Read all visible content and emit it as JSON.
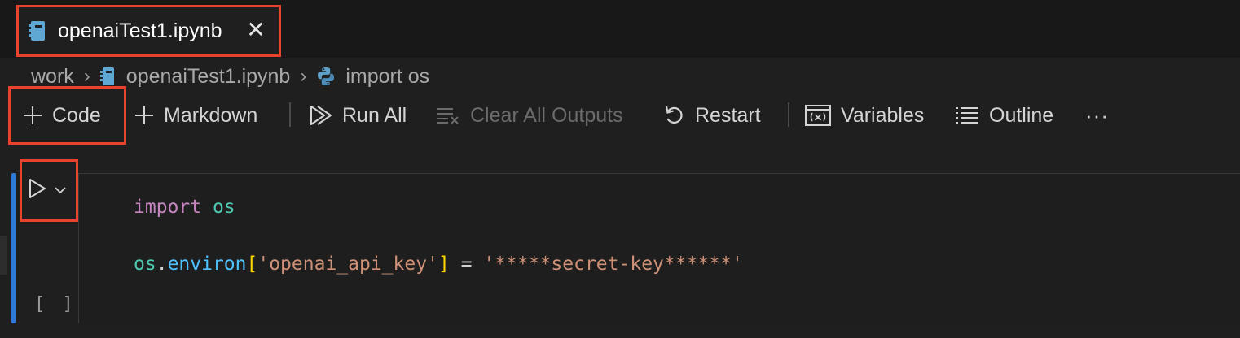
{
  "tab": {
    "title": "openaiTest1.ipynb",
    "close_glyph": "✕",
    "icon": "notebook-icon"
  },
  "breadcrumb": {
    "items": [
      "work",
      "openaiTest1.ipynb",
      "import os"
    ],
    "separator": "›"
  },
  "toolbar": {
    "code_label": "Code",
    "markdown_label": "Markdown",
    "run_all_label": "Run All",
    "clear_outputs_label": "Clear All Outputs",
    "restart_label": "Restart",
    "variables_label": "Variables",
    "outline_label": "Outline",
    "more_glyph": "···"
  },
  "cell": {
    "execution_count": "[ ]",
    "lines": [
      {
        "kw": "import",
        "id": "os"
      },
      {
        "obj": "os",
        "dot": ".",
        "prop": "environ",
        "lb": "[",
        "key": "'openai_api_key'",
        "rb": "]",
        "eq": " = ",
        "val": "'*****secret-key******'"
      }
    ]
  },
  "colors": {
    "accent": "#3079d6",
    "highlight": "#e8432d",
    "keyword": "#c586c0",
    "string": "#ce9178"
  }
}
